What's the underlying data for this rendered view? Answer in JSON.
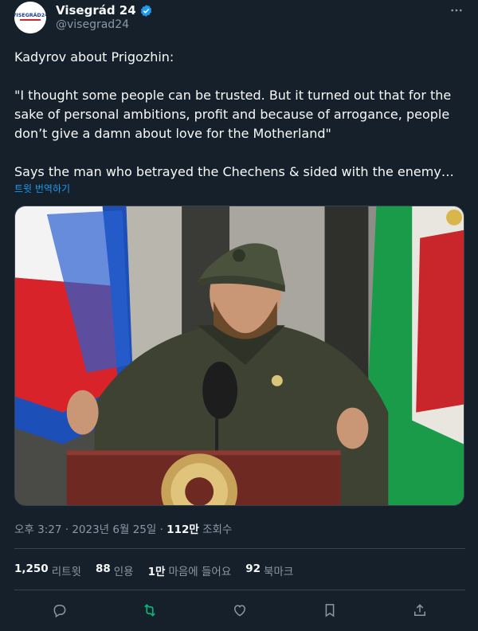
{
  "author": {
    "display_name": "Visegrád 24",
    "handle": "@visegrad24",
    "avatar_text": "VISEGRÁD24",
    "verified": true
  },
  "tweet": {
    "text": "Kadyrov about Prigozhin:\n\n\"I thought some people can be trusted. But it turned out that for the sake of personal ambitions, profit and because of arrogance, people don’t give a damn about love for the Motherland\"\n\nSays the man who betrayed the Chechens & sided with the enemy…",
    "translate_label": "트윗 번역하기"
  },
  "meta": {
    "time": "오후 3:27",
    "sep1": " · ",
    "date": "2023년 6월 25일",
    "sep2": " · ",
    "views_count": "112만",
    "views_label": " 조회수"
  },
  "stats": {
    "retweets": {
      "num": "1,250",
      "label": "리트윗"
    },
    "quotes": {
      "num": "88",
      "label": "인용"
    },
    "likes": {
      "num": "1만",
      "label": "마음에 들어요"
    },
    "bookmarks": {
      "num": "92",
      "label": "북마크"
    }
  },
  "icons": {
    "reply": "reply-icon",
    "retweet": "retweet-icon",
    "like": "heart-icon",
    "bookmark": "bookmark-icon",
    "share": "share-icon",
    "more": "more-icon",
    "verified": "verified-badge-icon"
  },
  "colors": {
    "background": "#15202b",
    "text": "#f7f9f9",
    "secondary": "#8b98a5",
    "link": "#1d9bf0",
    "retweet_active": "#00ba7c",
    "verified": "#1d9bf0"
  }
}
